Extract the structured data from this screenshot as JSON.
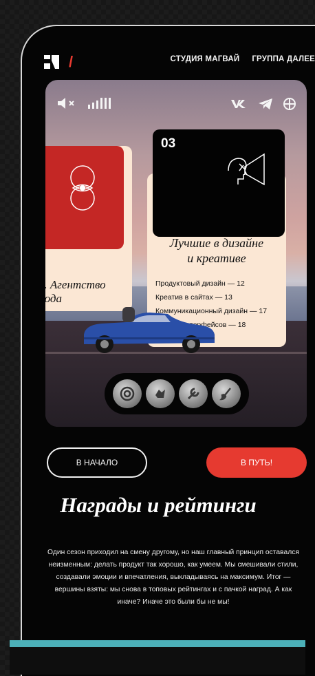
{
  "nav": {
    "studio": "СТУДИЯ МАГВАЙ",
    "group": "ГРУППА ДАЛЕЕ"
  },
  "icons": {
    "logo": "logo-icon",
    "sound": "mute-icon",
    "volume": "volume-bars-icon",
    "vk": "vk-icon",
    "telegram": "telegram-icon",
    "globe": "globe-icon"
  },
  "cards": {
    "left": {
      "title": "г. Агентство\nгода"
    },
    "main": {
      "number": "03",
      "title": "Лучшие в дизайне\nи креативе",
      "items": [
        "Продуктовый дизайн — 12",
        "Креатив в сайтах — 13",
        "Коммуникационный дизайн — 17",
        "Дизайн интерфейсов — 18"
      ]
    }
  },
  "badges": [
    "target-badge-icon",
    "hand-badge-icon",
    "wrench-badge-icon",
    "brush-badge-icon"
  ],
  "buttons": {
    "back": "В НАЧАЛО",
    "go": "В ПУТЬ!"
  },
  "heading": "Награды и рейтинги",
  "paragraph": "Один сезон приходил на смену другому, но наш главный принцип оставался неизменным: делать продукт так хорошо, как умеем. Мы смешивали стили, создавали эмоции и впечатления, выкладываясь на максимум. Итог — вершины взяты: мы снова в топовых рейтингах и с пачкой наград. А как иначе? Иначе это были бы не мы!",
  "chevrons": "›››",
  "colors": {
    "accent": "#e63a30",
    "card": "#fbe7d4",
    "teal": "#4cb0b8"
  }
}
